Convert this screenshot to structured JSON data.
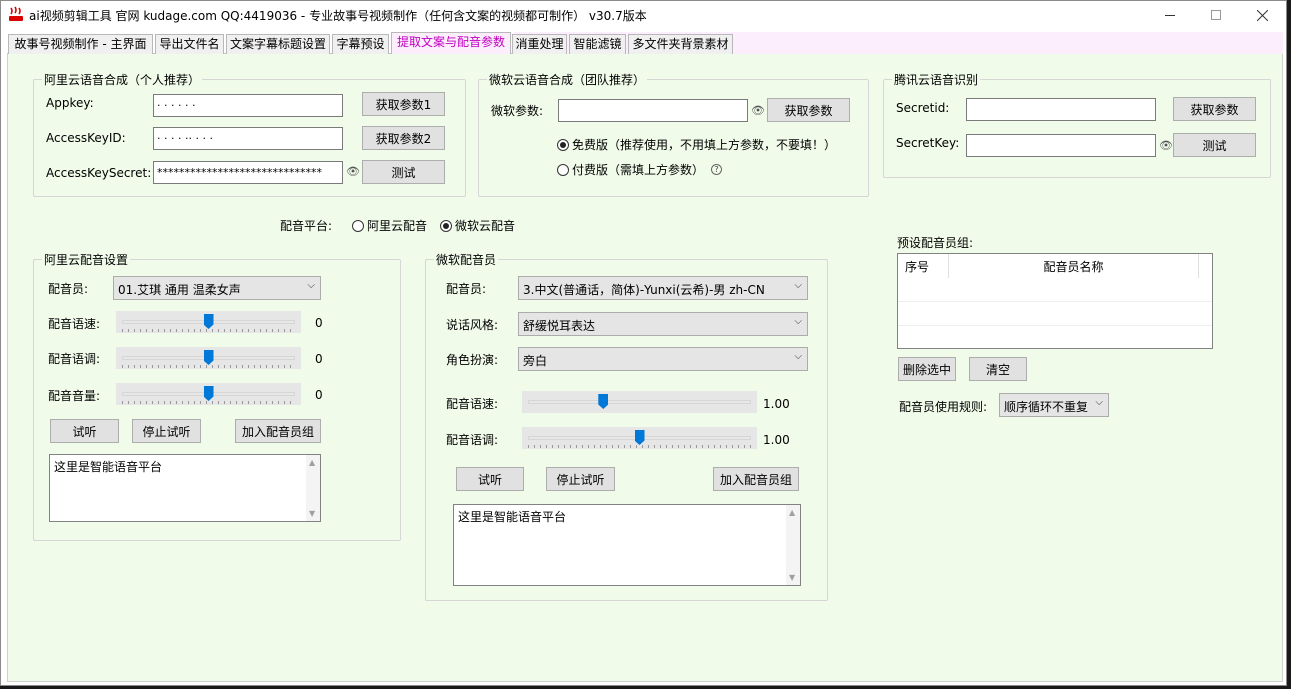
{
  "window": {
    "title": "ai视频剪辑工具 官网 kudage.com QQ:4419036 -  专业故事号视频制作（任何含文案的视频都可制作）  v30.7版本"
  },
  "tabs": [
    {
      "label": "故事号视频制作 - 主界面"
    },
    {
      "label": "导出文件名"
    },
    {
      "label": "文案字幕标题设置"
    },
    {
      "label": "字幕预设"
    },
    {
      "label": "提取文案与配音参数"
    },
    {
      "label": "消重处理"
    },
    {
      "label": "智能滤镜"
    },
    {
      "label": "多文件夹背景素材"
    }
  ],
  "aliyun": {
    "title": "阿里云语音合成（个人推荐）",
    "appkey_label": "Appkey:",
    "appkey_value": "·   · · · ·  ·",
    "accesskeyid_label": "AccessKeyID:",
    "accesskeyid_value": "· ·  ·  ·   ·· ·   · ·",
    "accesskeysecret_label": "AccessKeySecret:",
    "accesskeysecret_value": "******************************",
    "btn_get1": "获取参数1",
    "btn_get2": "获取参数2",
    "btn_test": "测试"
  },
  "microsoft": {
    "title": "微软云语音合成（团队推荐）",
    "param_label": "微软参数:",
    "param_value": "",
    "btn_get": "获取参数",
    "free_label": "免费版（推荐使用，不用填上方参数，不要填！）",
    "paid_label": "付费版（需填上方参数）",
    "help": "?"
  },
  "tencent": {
    "title": "腾讯云语音识别",
    "secretid_label": "Secretid:",
    "secretid_value": "",
    "secretkey_label": "SecretKey:",
    "secretkey_value": "",
    "btn_get": "获取参数",
    "btn_test": "测试"
  },
  "platform": {
    "label": "配音平台:",
    "aliyun": "阿里云配音",
    "microsoft": "微软云配音",
    "selected": "微软云配音"
  },
  "aliyun_voice": {
    "title": "阿里云配音设置",
    "voice_label": "配音员:",
    "voice_value": "01.艾琪 通用 温柔女声",
    "speed_label": "配音语速:",
    "speed_value": "0",
    "speed_level": 0.5,
    "pitch_label": "配音语调:",
    "pitch_value": "0",
    "pitch_level": 0.5,
    "volume_label": "配音音量:",
    "volume_value": "0",
    "volume_level": 0.5,
    "btn_listen": "试听",
    "btn_stop": "停止试听",
    "btn_add": "加入配音员组",
    "text": "这里是智能语音平台"
  },
  "ms_voice": {
    "title": "微软配音员",
    "voice_label": "配音员:",
    "voice_value": "3.中文(普通话，简体)-Yunxi(云希)-男 zh-CN",
    "style_label": "说话风格:",
    "style_value": "舒缓悦耳表达",
    "role_label": "角色扮演:",
    "role_value": "旁白",
    "speed_label": "配音语速:",
    "speed_value": "1.00",
    "speed_level": 0.33,
    "pitch_label": "配音语调:",
    "pitch_value": "1.00",
    "pitch_level": 0.5,
    "btn_listen": "试听",
    "btn_stop": "停止试听",
    "btn_add": "加入配音员组",
    "text": "这里是智能语音平台"
  },
  "preset": {
    "title": "预设配音员组:",
    "col_index": "序号",
    "col_name": "配音员名称",
    "btn_delete": "删除选中",
    "btn_clear": "清空",
    "rule_label": "配音员使用规则:",
    "rule_value": "顺序循环不重复"
  }
}
